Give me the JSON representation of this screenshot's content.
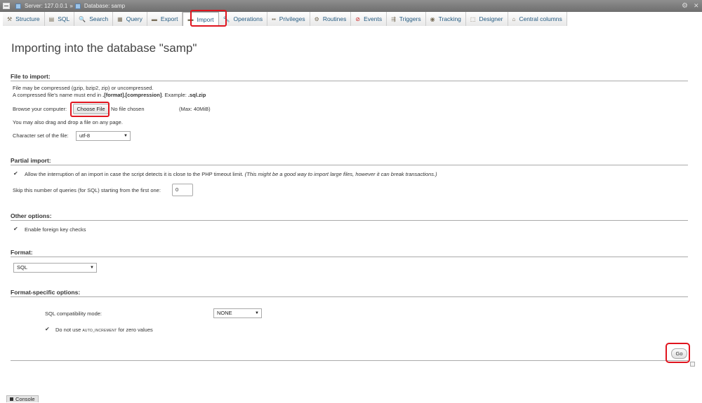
{
  "topbar": {
    "server": "Server: 127.0.0.1",
    "separator": "»",
    "database": "Database: samp"
  },
  "tabs": [
    {
      "label": "Structure",
      "icon": "structure-icon"
    },
    {
      "label": "SQL",
      "icon": "sql-icon"
    },
    {
      "label": "Search",
      "icon": "search-icon"
    },
    {
      "label": "Query",
      "icon": "query-icon"
    },
    {
      "label": "Export",
      "icon": "export-icon"
    },
    {
      "label": "Import",
      "icon": "import-icon"
    },
    {
      "label": "Operations",
      "icon": "operations-icon"
    },
    {
      "label": "Privileges",
      "icon": "privileges-icon"
    },
    {
      "label": "Routines",
      "icon": "routines-icon"
    },
    {
      "label": "Events",
      "icon": "events-icon"
    },
    {
      "label": "Triggers",
      "icon": "triggers-icon"
    },
    {
      "label": "Tracking",
      "icon": "tracking-icon"
    },
    {
      "label": "Designer",
      "icon": "designer-icon"
    },
    {
      "label": "Central columns",
      "icon": "central-columns-icon"
    }
  ],
  "page_title": "Importing into the database \"samp\"",
  "file_section": {
    "heading": "File to import:",
    "line1": "File may be compressed (gzip, bzip2, zip) or uncompressed.",
    "line2_pre": "A compressed file's name must end in ",
    "line2_format": ".[format].[compression]",
    "line2_mid": ". Example: ",
    "line2_example": ".sql.zip",
    "browse_label": "Browse your computer:",
    "choose_file": "Choose File",
    "no_file": "No file chosen",
    "max_size": "(Max: 40MiB)",
    "drag_hint": "You may also drag and drop a file on any page.",
    "charset_label": "Character set of the file:",
    "charset_value": "utf-8"
  },
  "partial_section": {
    "heading": "Partial import:",
    "allow_interrupt": "Allow the interruption of an import in case the script detects it is close to the PHP timeout limit.",
    "allow_interrupt_note": "(This might be a good way to import large files, however it can break transactions.)",
    "skip_label": "Skip this number of queries (for SQL) starting from the first one:",
    "skip_value": "0"
  },
  "other_section": {
    "heading": "Other options:",
    "foreign_key": "Enable foreign key checks"
  },
  "format_section": {
    "heading": "Format:",
    "value": "SQL"
  },
  "format_specific": {
    "heading": "Format-specific options:",
    "compat_label": "SQL compatibility mode:",
    "compat_value": "NONE",
    "auto_pre": "Do not use ",
    "auto_code": "AUTO_INCREMENT",
    "auto_post": " for zero values"
  },
  "go_label": "Go",
  "console_label": "Console",
  "colors": {
    "highlight": "#e0141e",
    "link": "#235a81"
  }
}
